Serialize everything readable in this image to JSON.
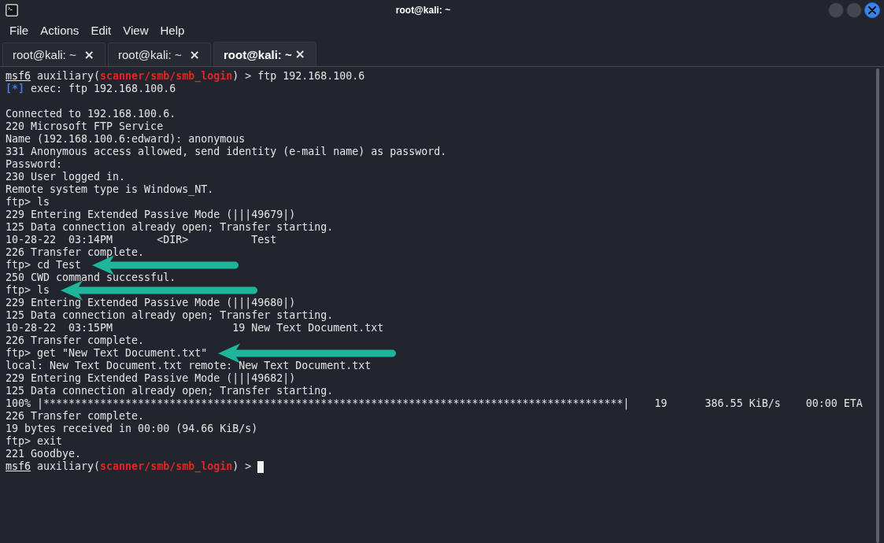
{
  "window": {
    "title": "root@kali: ~"
  },
  "menu": [
    "File",
    "Actions",
    "Edit",
    "View",
    "Help"
  ],
  "tabs": [
    {
      "label": "root@kali: ~",
      "close": "×",
      "selected": false
    },
    {
      "label": "root@kali: ~",
      "close": "×",
      "selected": false
    },
    {
      "label": "root@kali: ~",
      "close": "×",
      "selected": true
    }
  ],
  "terminal": {
    "cursor": true,
    "lines": [
      {
        "kind": "rich",
        "arrow": false,
        "segments": [
          {
            "kind": "prompt",
            "text": "msf6"
          },
          {
            "kind": "plain",
            "text": " auxiliary("
          },
          {
            "kind": "module",
            "text": "scanner/smb/smb_login"
          },
          {
            "kind": "plain",
            "text": ") > ftp 192.168.100.6"
          }
        ]
      },
      {
        "kind": "rich",
        "arrow": false,
        "segments": [
          {
            "kind": "info",
            "text": "[*]"
          },
          {
            "kind": "plain",
            "text": " exec: ftp 192.168.100.6"
          }
        ]
      },
      {
        "kind": "blank"
      },
      {
        "kind": "output",
        "arrow": false,
        "text": "Connected to 192.168.100.6."
      },
      {
        "kind": "output",
        "arrow": false,
        "text": "220 Microsoft FTP Service"
      },
      {
        "kind": "output",
        "arrow": false,
        "text": "Name (192.168.100.6:edward): anonymous"
      },
      {
        "kind": "output",
        "arrow": false,
        "text": "331 Anonymous access allowed, send identity (e-mail name) as password."
      },
      {
        "kind": "output",
        "arrow": false,
        "text": "Password:"
      },
      {
        "kind": "output",
        "arrow": false,
        "text": "230 User logged in."
      },
      {
        "kind": "output",
        "arrow": false,
        "text": "Remote system type is Windows_NT."
      },
      {
        "kind": "output",
        "arrow": false,
        "text": "ftp> ls"
      },
      {
        "kind": "output",
        "arrow": false,
        "text": "229 Entering Extended Passive Mode (|||49679|)"
      },
      {
        "kind": "output",
        "arrow": false,
        "text": "125 Data connection already open; Transfer starting."
      },
      {
        "kind": "output",
        "arrow": false,
        "text": "10-28-22  03:14PM       <DIR>          Test"
      },
      {
        "kind": "output",
        "arrow": false,
        "text": "226 Transfer complete."
      },
      {
        "kind": "output",
        "arrow": true,
        "text": "ftp> cd Test"
      },
      {
        "kind": "output",
        "arrow": false,
        "text": "250 CWD command successful."
      },
      {
        "kind": "output",
        "arrow": true,
        "text": "ftp> ls"
      },
      {
        "kind": "output",
        "arrow": false,
        "text": "229 Entering Extended Passive Mode (|||49680|)"
      },
      {
        "kind": "output",
        "arrow": false,
        "text": "125 Data connection already open; Transfer starting."
      },
      {
        "kind": "output",
        "arrow": false,
        "text": "10-28-22  03:15PM                   19 New Text Document.txt"
      },
      {
        "kind": "output",
        "arrow": false,
        "text": "226 Transfer complete."
      },
      {
        "kind": "output",
        "arrow": true,
        "text": "ftp> get \"New Text Document.txt\""
      },
      {
        "kind": "output",
        "arrow": false,
        "text": "local: New Text Document.txt remote: New Text Document.txt"
      },
      {
        "kind": "output",
        "arrow": false,
        "text": "229 Entering Extended Passive Mode (|||49682|)"
      },
      {
        "kind": "output",
        "arrow": false,
        "text": "125 Data connection already open; Transfer starting."
      },
      {
        "kind": "output",
        "arrow": false,
        "text": "100% |********************************************************************************************|    19      386.55 KiB/s    00:00 ETA"
      },
      {
        "kind": "output",
        "arrow": false,
        "text": "226 Transfer complete."
      },
      {
        "kind": "output",
        "arrow": false,
        "text": "19 bytes received in 00:00 (94.66 KiB/s)"
      },
      {
        "kind": "output",
        "arrow": false,
        "text": "ftp> exit"
      },
      {
        "kind": "output",
        "arrow": false,
        "text": "221 Goodbye."
      },
      {
        "kind": "rich",
        "arrow": false,
        "segments": [
          {
            "kind": "prompt",
            "text": "msf6"
          },
          {
            "kind": "plain",
            "text": " auxiliary("
          },
          {
            "kind": "module",
            "text": "scanner/smb/smb_login"
          },
          {
            "kind": "plain",
            "text": ") >"
          }
        ]
      }
    ]
  }
}
